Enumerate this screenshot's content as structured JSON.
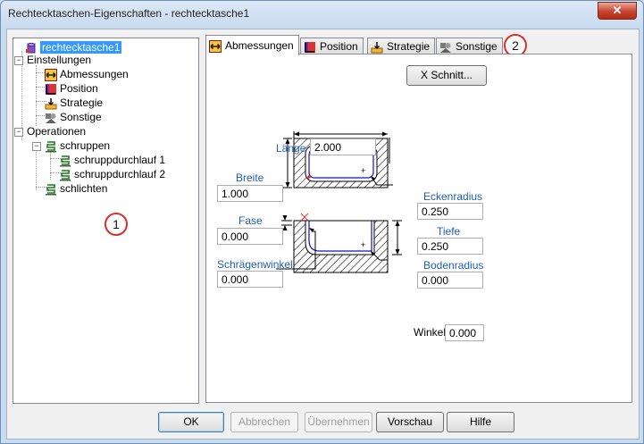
{
  "window": {
    "title": "Rechtecktaschen-Eigenschaften - rechtecktasche1",
    "close_glyph": "✕"
  },
  "tree": {
    "root": "rechtecktasche1",
    "settings": "Einstellungen",
    "settings_items": [
      "Abmessungen",
      "Position",
      "Strategie",
      "Sonstige"
    ],
    "operations": "Operationen",
    "roughing": "schruppen",
    "roughing_passes": [
      "schruppdurchlauf 1",
      "schruppdurchlauf 2"
    ],
    "finishing": "schlichten",
    "expander_collapse": "−"
  },
  "markers": {
    "tree": "1",
    "tabs": "2"
  },
  "tabs": [
    "Abmessungen",
    "Position",
    "Strategie",
    "Sonstige"
  ],
  "dimensions": {
    "section_button": "X Schnitt...",
    "laenge_label": "Länge",
    "laenge_value": "2.000",
    "breite_label": "Breite",
    "breite_value": "1.000",
    "eckenradius_label": "Eckenradius",
    "eckenradius_value": "0.250",
    "fase_label": "Fase",
    "fase_value": "0.000",
    "tiefe_label": "Tiefe",
    "tiefe_value": "0.250",
    "schraegenwinkel_label": "Schrägenwinkel",
    "schraegenwinkel_value": "0.000",
    "bodenradius_label": "Bodenradius",
    "bodenradius_value": "0.000",
    "winkel_label": "Winkel",
    "winkel_value": "0.000"
  },
  "buttons": {
    "ok": "OK",
    "cancel": "Abbrechen",
    "apply": "Übernehmen",
    "preview": "Vorschau",
    "help": "Hilfe"
  },
  "colors": {
    "selection": "#3399ff",
    "label_blue": "#1f5fb0",
    "marker_red": "#d9302a",
    "close_red": "#c7432f"
  }
}
